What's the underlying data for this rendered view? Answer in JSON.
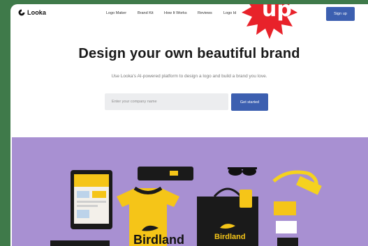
{
  "nav": {
    "logo_text": "Looka",
    "links": [
      "Logo Maker",
      "Brand Kit",
      "How It Works",
      "Reviews",
      "Logo Id"
    ],
    "signup_label": "Sign up"
  },
  "badge": {
    "text": "up",
    "color": "#e8222a"
  },
  "hero": {
    "title": "Design your own beautiful brand",
    "subtitle": "Use Looka's AI-powered platform to design a logo and build a brand you love.",
    "input_placeholder": "Enter your company name",
    "cta_label": "Get started"
  },
  "showcase": {
    "brand_name": "Birdland",
    "bag_brand": "Birdland",
    "colors": {
      "background": "#a890d2",
      "yellow": "#f5c518",
      "black": "#1a1a1a"
    }
  },
  "colors": {
    "accent": "#3c5fb0",
    "outer": "#3f7a4a"
  }
}
